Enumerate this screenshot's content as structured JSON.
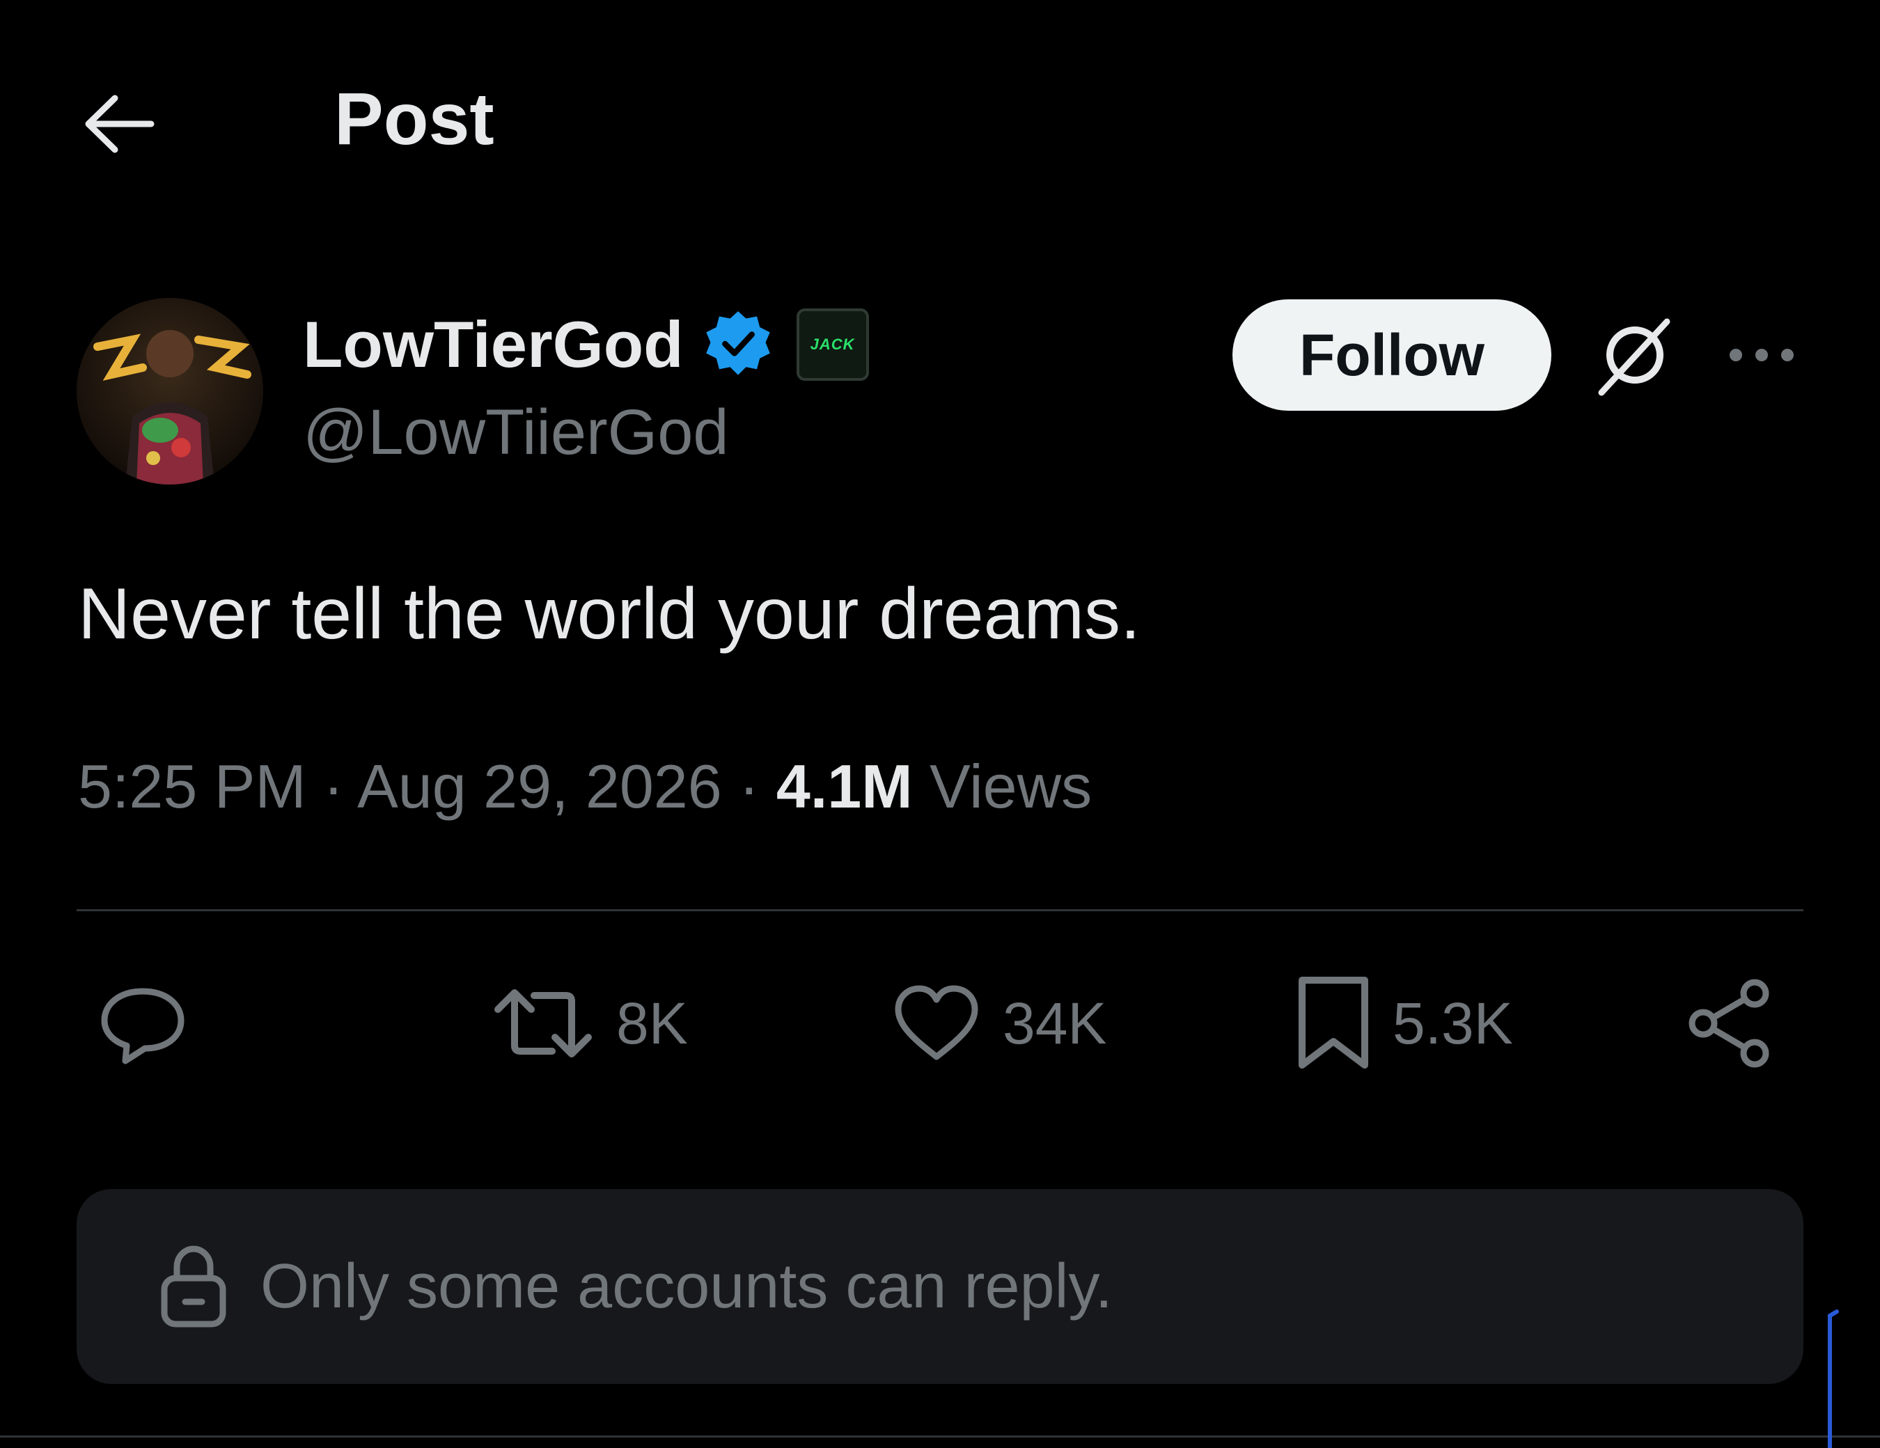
{
  "header": {
    "title": "Post",
    "back_icon": "arrow-left-icon"
  },
  "author": {
    "display_name": "LowTierGod",
    "handle": "@LowTiierGod",
    "verified_color": "#1d9bf0",
    "affiliate_badge_text": "JACK"
  },
  "follow_button": {
    "label": "Follow"
  },
  "post": {
    "text": "Never tell the world your dreams.",
    "time": "5:25 PM",
    "date": "Aug 29, 2026",
    "separator": "·",
    "views_count": "4.1M",
    "views_label": "Views"
  },
  "actions": {
    "reply": {
      "icon": "reply-icon",
      "count": ""
    },
    "repost": {
      "icon": "repost-icon",
      "count": "8K"
    },
    "like": {
      "icon": "heart-icon",
      "count": "34K"
    },
    "bookmark": {
      "icon": "bookmark-icon",
      "count": "5.3K"
    },
    "share": {
      "icon": "share-icon",
      "count": ""
    }
  },
  "reply_restriction": {
    "icon": "lock-icon",
    "message": "Only some accounts can reply."
  },
  "colors": {
    "background": "#000000",
    "text_primary": "#e7e9ea",
    "text_secondary": "#71767b",
    "accent": "#1d9bf0",
    "divider": "#2f3336"
  }
}
